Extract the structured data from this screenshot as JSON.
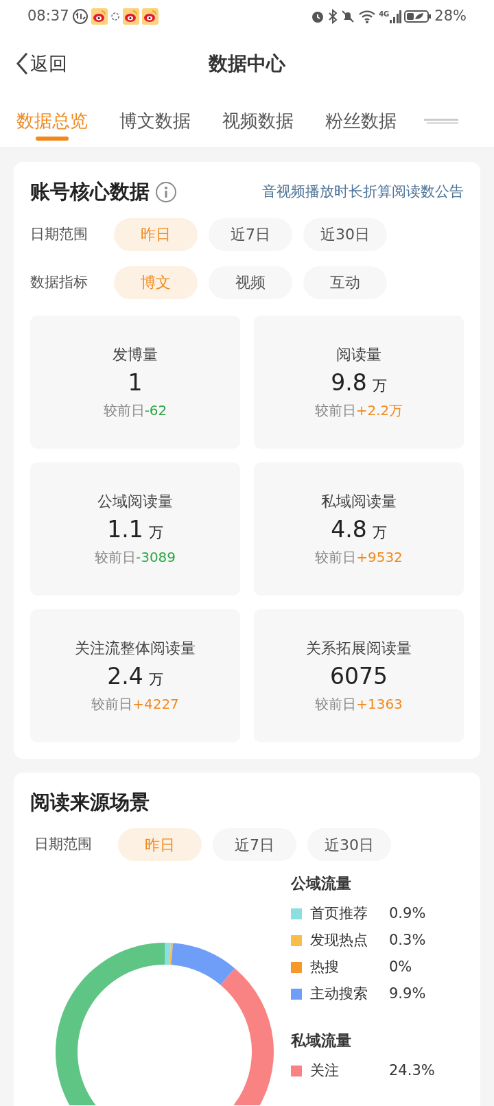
{
  "status_bar": {
    "time": "08:37",
    "battery": "28%",
    "network": "4G"
  },
  "header": {
    "back": "返回",
    "title": "数据中心"
  },
  "tabs": [
    {
      "label": "数据总览",
      "selected": true
    },
    {
      "label": "博文数据",
      "selected": false
    },
    {
      "label": "视频数据",
      "selected": false
    },
    {
      "label": "粉丝数据",
      "selected": false
    }
  ],
  "core_card": {
    "title": "账号核心数据",
    "link": "音视频播放时长折算阅读数公告",
    "filters": [
      {
        "label": "日期范围",
        "options": [
          {
            "label": "昨日",
            "selected": true
          },
          {
            "label": "近7日",
            "selected": false
          },
          {
            "label": "近30日",
            "selected": false
          }
        ]
      },
      {
        "label": "数据指标",
        "options": [
          {
            "label": "博文",
            "selected": true
          },
          {
            "label": "视频",
            "selected": false
          },
          {
            "label": "互动",
            "selected": false
          }
        ]
      }
    ],
    "metrics": [
      {
        "name": "发博量",
        "value": "1",
        "compare": "较前日",
        "delta": "-62",
        "increase": false
      },
      {
        "name": "阅读量",
        "value": "9.8",
        "unit": "万",
        "compare": "较前日",
        "delta": "+2.2万",
        "increase": true
      },
      {
        "name": "公域阅读量",
        "value": "1.1",
        "unit": "万",
        "compare": "较前日",
        "delta": "-3089",
        "increase": false
      },
      {
        "name": "私域阅读量",
        "value": "4.8",
        "unit": "万",
        "compare": "较前日",
        "delta": "+9532",
        "increase": true
      },
      {
        "name": "关注流整体阅读量",
        "value": "2.4",
        "unit": "万",
        "compare": "较前日",
        "delta": "+4227",
        "increase": true
      },
      {
        "name": "关系拓展阅读量",
        "value": "6075",
        "compare": "较前日",
        "delta": "+1363",
        "increase": true
      }
    ]
  },
  "source_card": {
    "title": "阅读来源场景",
    "filter": {
      "label": "日期范围",
      "options": [
        {
          "label": "昨日",
          "selected": true
        },
        {
          "label": "近7日",
          "selected": false
        },
        {
          "label": "近30日",
          "selected": false
        }
      ]
    },
    "legend_groups": [
      {
        "title": "公域流量",
        "items": [
          {
            "label": "首页推荐",
            "value": "0.9%",
            "color": "#8adfe0"
          },
          {
            "label": "发现热点",
            "value": "0.3%",
            "color": "#fbbd4a"
          },
          {
            "label": "热搜",
            "value": "0%",
            "color": "#f7982a"
          },
          {
            "label": "主动搜索",
            "value": "9.9%",
            "color": "#6f9ef8"
          }
        ]
      },
      {
        "title": "私域流量",
        "items": [
          {
            "label": "关注",
            "value": "24.3%",
            "color": "#f98383"
          }
        ]
      }
    ],
    "chart_data": {
      "type": "donut",
      "values": [
        0.9,
        0.3,
        9.9,
        24.3,
        64.6
      ],
      "colors": [
        "#8adfe0",
        "#fbbd4a",
        "#6f9ef8",
        "#f98383",
        "#5ec585"
      ]
    }
  }
}
